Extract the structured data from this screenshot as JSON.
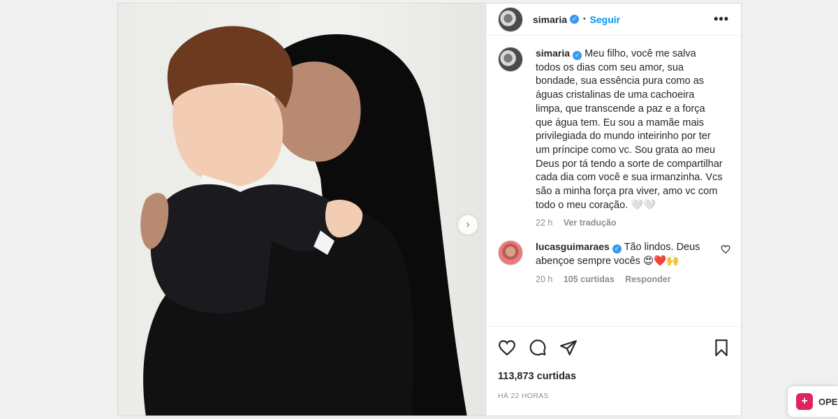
{
  "post": {
    "username": "simaria",
    "follow_label": "Seguir",
    "separator": "•",
    "more_label": "•••",
    "next_label": "›"
  },
  "caption": {
    "username": "simaria",
    "text": "Meu filho, você me salva todos os dias com seu amor, sua bondade, sua essência pura como as águas cristalinas de uma cachoeira limpa, que transcende a paz e a força que água tem. Eu sou a mamãe mais privilegiada do mundo inteirinho por ter um príncipe como vc. Sou grata ao meu Deus por tá tendo a sorte de compartilhar cada dia com você e sua irmanzinha. Vcs são a minha força pra viver, amo vc com todo o meu coração. 🤍🤍",
    "time": "22 h",
    "translate": "Ver tradução"
  },
  "comment": {
    "username": "lucasguimaraes",
    "text": "Tão lindos. Deus abençoe sempre vocês 😍❤️🙌",
    "time": "20 h",
    "likes": "105 curtidas",
    "reply": "Responder"
  },
  "stats": {
    "likes": "113,873 curtidas",
    "posted": "HÁ 22 HORAS"
  },
  "badge": {
    "label": "OPE",
    "icon": "+"
  },
  "colors": {
    "accent": "#0095f6",
    "verified": "#3897f0",
    "badge": "#e0245e"
  }
}
